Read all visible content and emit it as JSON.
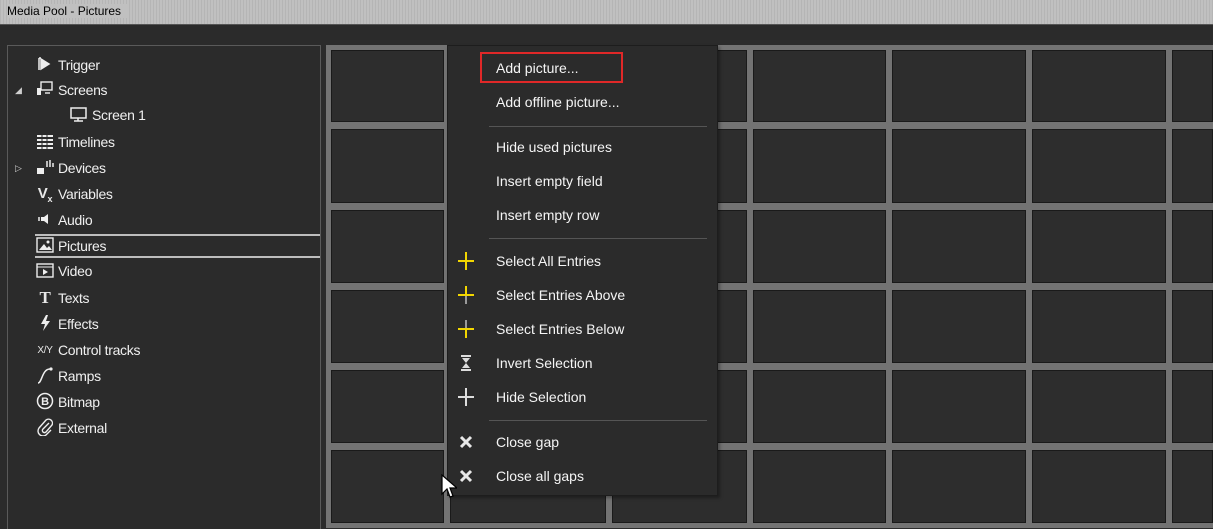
{
  "window": {
    "title": "Media Pool - Pictures"
  },
  "tree": {
    "items": [
      {
        "label": "Trigger",
        "icon": "trigger-icon"
      },
      {
        "label": "Screens",
        "icon": "screens-icon",
        "expander": "expanded"
      },
      {
        "label": "Screen 1",
        "icon": "screen-icon"
      },
      {
        "label": "Timelines",
        "icon": "timelines-icon"
      },
      {
        "label": "Devices",
        "icon": "devices-icon",
        "expander": "collapsed"
      },
      {
        "label": "Variables",
        "icon": "variables-icon"
      },
      {
        "label": "Audio",
        "icon": "audio-icon"
      },
      {
        "label": "Pictures",
        "icon": "pictures-icon",
        "selected": true
      },
      {
        "label": "Video",
        "icon": "video-icon"
      },
      {
        "label": "Texts",
        "icon": "texts-icon"
      },
      {
        "label": "Effects",
        "icon": "effects-icon"
      },
      {
        "label": "Control tracks",
        "icon": "control-tracks-icon"
      },
      {
        "label": "Ramps",
        "icon": "ramps-icon"
      },
      {
        "label": "Bitmap",
        "icon": "bitmap-icon"
      },
      {
        "label": "External",
        "icon": "external-icon"
      }
    ]
  },
  "context_menu": {
    "items": [
      {
        "label": "Add picture...",
        "highlighted": true
      },
      {
        "label": "Add offline picture..."
      },
      {
        "label": "Hide used pictures"
      },
      {
        "label": "Insert empty field"
      },
      {
        "label": "Insert empty row"
      },
      {
        "label": "Select All Entries",
        "icon": "select-all-icon"
      },
      {
        "label": "Select Entries Above",
        "icon": "select-above-icon"
      },
      {
        "label": "Select Entries Below",
        "icon": "select-below-icon"
      },
      {
        "label": "Invert Selection",
        "icon": "invert-selection-icon"
      },
      {
        "label": "Hide Selection",
        "icon": "hide-selection-icon"
      },
      {
        "label": "Close gap",
        "icon": "close-gap-icon"
      },
      {
        "label": "Close all gaps",
        "icon": "close-all-gaps-icon"
      }
    ]
  },
  "colors": {
    "highlight_border": "#e02828",
    "icon_yellow": "#f2d600",
    "grid_line": "#737373",
    "cell_bg": "#2d2d2d"
  }
}
